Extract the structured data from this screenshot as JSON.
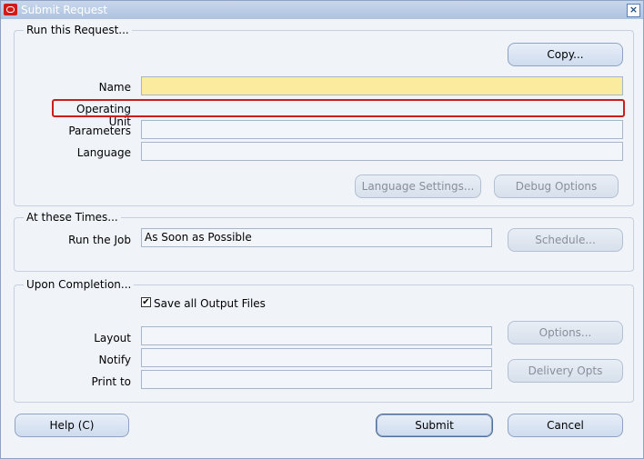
{
  "window": {
    "title": "Submit Request",
    "close_glyph": "×"
  },
  "run_request": {
    "group_title": "Run this Request...",
    "copy_button": "Copy...",
    "name_label": "Name",
    "name_value": "",
    "operating_unit_label": "Operating Unit",
    "operating_unit_value": "",
    "parameters_label": "Parameters",
    "parameters_value": "",
    "language_label": "Language",
    "language_value": "",
    "language_settings_button": "Language Settings...",
    "debug_options_button": "Debug Options"
  },
  "times": {
    "group_title": "At these Times...",
    "run_job_label": "Run the Job",
    "run_job_value": "As Soon as Possible",
    "schedule_button": "Schedule..."
  },
  "completion": {
    "group_title": "Upon Completion...",
    "save_output_label": "Save all Output Files",
    "save_output_checked": true,
    "check_glyph": "✔",
    "layout_label": "Layout",
    "layout_value": "",
    "notify_label": "Notify",
    "notify_value": "",
    "print_to_label": "Print to",
    "print_to_value": "",
    "options_button": "Options...",
    "delivery_opts_button": "Delivery Opts"
  },
  "footer": {
    "help_button": "Help (C)",
    "submit_button": "Submit",
    "cancel_button": "Cancel"
  },
  "colors": {
    "required_field": "#fbeb9f",
    "highlight_border": "#cc1d1d",
    "titlebar": "#aec3e0"
  }
}
